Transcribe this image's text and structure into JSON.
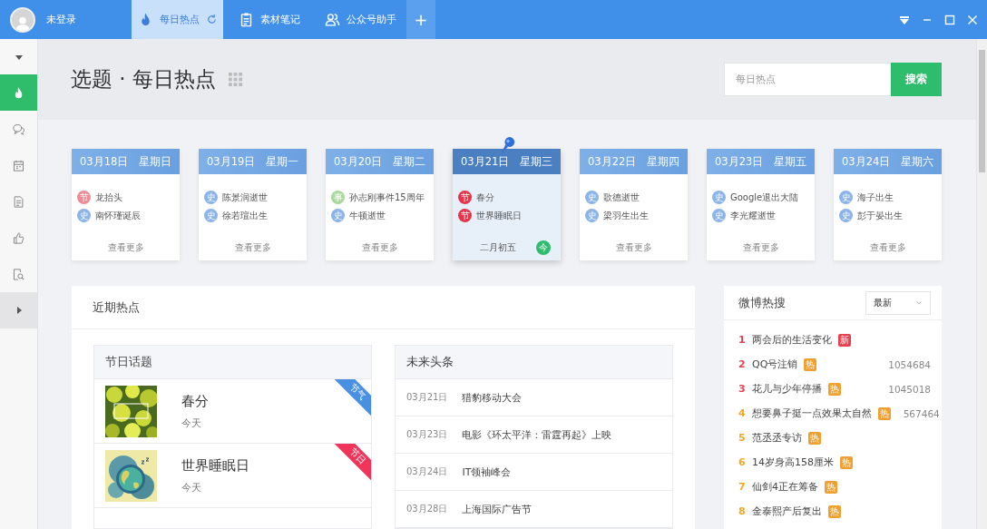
{
  "user": {
    "name": "未登录"
  },
  "tabs": [
    {
      "label": "每日热点",
      "selected": true
    },
    {
      "label": "素材笔记",
      "selected": false
    },
    {
      "label": "公众号助手",
      "selected": false
    }
  ],
  "add_tab": "+",
  "sidebar": {
    "items": [
      {
        "selected": true
      },
      {
        "selected": false
      },
      {
        "selected": false
      },
      {
        "selected": false
      },
      {
        "selected": false
      },
      {
        "selected": false
      }
    ]
  },
  "page": {
    "title": "选题 · 每日热点"
  },
  "search": {
    "placeholder": "每日热点",
    "button": "搜索"
  },
  "calendar": [
    {
      "date": "03月18日",
      "weekday": "星期日",
      "selected": false,
      "footer": "查看更多",
      "events": [
        {
          "tag": "节",
          "color": "#f08a94",
          "text": "龙抬头"
        },
        {
          "tag": "史",
          "color": "#8ab4ea",
          "text": "南怀瑾诞辰"
        }
      ]
    },
    {
      "date": "03月19日",
      "weekday": "星期一",
      "selected": false,
      "footer": "查看更多",
      "events": [
        {
          "tag": "史",
          "color": "#8ab4ea",
          "text": "陈景润逝世"
        },
        {
          "tag": "史",
          "color": "#8ab4ea",
          "text": "徐若瑄出生"
        }
      ]
    },
    {
      "date": "03月20日",
      "weekday": "星期二",
      "selected": false,
      "footer": "查看更多",
      "events": [
        {
          "tag": "事",
          "color": "#a8d89a",
          "text": "孙志刚事件15周年"
        },
        {
          "tag": "史",
          "color": "#8ab4ea",
          "text": "牛顿逝世"
        }
      ]
    },
    {
      "date": "03月21日",
      "weekday": "星期三",
      "selected": true,
      "footer": "二月初五",
      "badge": "今",
      "events": [
        {
          "tag": "节",
          "color": "#e8334a",
          "text": "春分"
        },
        {
          "tag": "节",
          "color": "#e8334a",
          "text": "世界睡眠日"
        }
      ]
    },
    {
      "date": "03月22日",
      "weekday": "星期四",
      "selected": false,
      "footer": "查看更多",
      "events": [
        {
          "tag": "史",
          "color": "#8ab4ea",
          "text": "歌德逝世"
        },
        {
          "tag": "史",
          "color": "#8ab4ea",
          "text": "梁羽生出生"
        }
      ]
    },
    {
      "date": "03月23日",
      "weekday": "星期五",
      "selected": false,
      "footer": "查看更多",
      "events": [
        {
          "tag": "史",
          "color": "#8ab4ea",
          "text": "Google退出大陆"
        },
        {
          "tag": "史",
          "color": "#8ab4ea",
          "text": "李光耀逝世"
        }
      ]
    },
    {
      "date": "03月24日",
      "weekday": "星期六",
      "selected": false,
      "footer": "查看更多",
      "events": [
        {
          "tag": "史",
          "color": "#8ab4ea",
          "text": "海子出生"
        },
        {
          "tag": "史",
          "color": "#8ab4ea",
          "text": "彭于晏出生"
        }
      ]
    }
  ],
  "recent": {
    "title": "近期热点",
    "festivals": {
      "title": "节日话题",
      "items": [
        {
          "name": "春分",
          "when": "今天",
          "ribbon": "节气",
          "color": "#4a90e2"
        },
        {
          "name": "世界睡眠日",
          "when": "今天",
          "ribbon": "节日",
          "color": "#f0345a"
        }
      ]
    },
    "headlines": {
      "title": "未来头条",
      "items": [
        {
          "date": "03月21日",
          "text": "猎豹移动大会"
        },
        {
          "date": "03月23日",
          "text": "电影《环太平洋：雷霆再起》上映"
        },
        {
          "date": "03月24日",
          "text": "IT领袖峰会"
        },
        {
          "date": "03月28日",
          "text": "上海国际广告节"
        }
      ]
    }
  },
  "weibo": {
    "title": "微博热搜",
    "sort": "最新",
    "items": [
      {
        "rank": "1",
        "text": "两会后的生活变化",
        "tag": "新",
        "color": "#e8404f"
      },
      {
        "rank": "2",
        "text": "QQ号注销",
        "tag": "热",
        "color": "#f0a030",
        "count": "1054684"
      },
      {
        "rank": "3",
        "text": "花儿与少年停播",
        "tag": "热",
        "color": "#f0a030",
        "count": "1045018"
      },
      {
        "rank": "4",
        "text": "想要鼻子挺一点效果太自然",
        "tag": "热",
        "color": "#f0a030",
        "count": "567464"
      },
      {
        "rank": "5",
        "text": "范丞丞专访",
        "tag": "热",
        "color": "#f0a030"
      },
      {
        "rank": "6",
        "text": "14岁身高158厘米",
        "tag": "热",
        "color": "#f0a030"
      },
      {
        "rank": "7",
        "text": "仙剑4正在筹备",
        "tag": "热",
        "color": "#f0a030"
      },
      {
        "rank": "8",
        "text": "金泰熙产后复出",
        "tag": "热",
        "color": "#f0a030"
      }
    ]
  }
}
